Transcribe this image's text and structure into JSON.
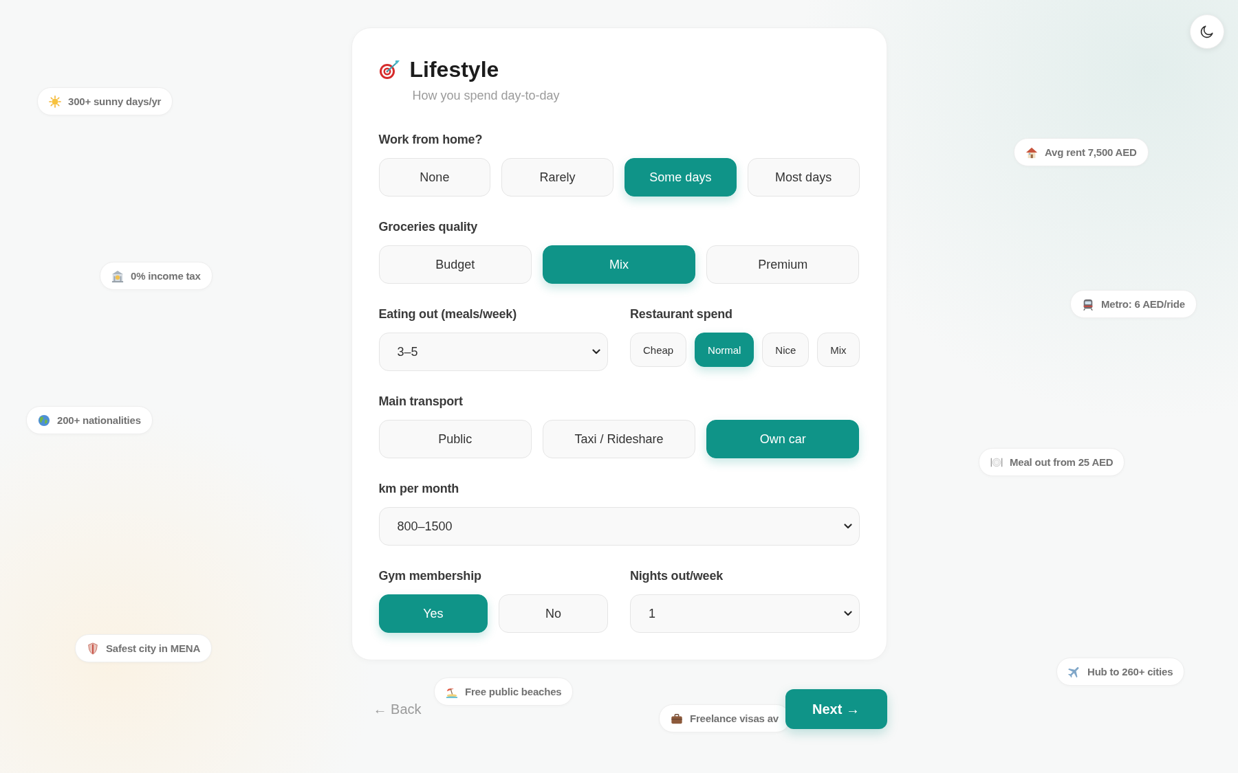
{
  "fact_chips": [
    {
      "label": "300+ sunny days/yr"
    },
    {
      "label": "Avg rent 7,500 AED"
    },
    {
      "label": "0% income tax"
    },
    {
      "label": "Metro: 6 AED/ride"
    },
    {
      "label": "200+ nationalities"
    },
    {
      "label": "Meal out from 25 AED"
    },
    {
      "label": "Safest city in MENA"
    },
    {
      "label": "Hub to 260+ cities"
    },
    {
      "label": "Free public beaches"
    },
    {
      "label": "Freelance visas av"
    }
  ],
  "card": {
    "title": "Lifestyle",
    "subtitle": "How you spend day-to-day",
    "rows": [
      {
        "fields": [
          {
            "label": "Work from home?",
            "kind": "choice",
            "options": [
              {
                "label": "None",
                "selected": false
              },
              {
                "label": "Rarely",
                "selected": false
              },
              {
                "label": "Some days",
                "selected": true
              },
              {
                "label": "Most days",
                "selected": false
              }
            ]
          }
        ]
      },
      {
        "fields": [
          {
            "label": "Groceries quality",
            "kind": "choice",
            "options": [
              {
                "label": "Budget",
                "selected": false
              },
              {
                "label": "Mix",
                "selected": true
              },
              {
                "label": "Premium",
                "selected": false
              }
            ]
          }
        ]
      },
      {
        "fields": [
          {
            "label": "Eating out (meals/week)",
            "kind": "select",
            "value": "3–5"
          },
          {
            "label": "Restaurant spend",
            "kind": "pills",
            "options": [
              {
                "label": "Cheap",
                "selected": false
              },
              {
                "label": "Normal",
                "selected": true
              },
              {
                "label": "Nice",
                "selected": false
              },
              {
                "label": "Mix",
                "selected": false
              }
            ]
          }
        ]
      },
      {
        "fields": [
          {
            "label": "Main transport",
            "kind": "choice",
            "options": [
              {
                "label": "Public",
                "selected": false
              },
              {
                "label": "Taxi / Rideshare",
                "selected": false
              },
              {
                "label": "Own car",
                "selected": true
              }
            ]
          }
        ]
      },
      {
        "fields": [
          {
            "label": "km per month",
            "kind": "select",
            "value": "800–1500"
          }
        ]
      },
      {
        "fields": [
          {
            "label": "Gym membership",
            "kind": "choice",
            "options": [
              {
                "label": "Yes",
                "selected": true
              },
              {
                "label": "No",
                "selected": false
              }
            ]
          },
          {
            "label": "Nights out/week",
            "kind": "select",
            "value": "1"
          }
        ]
      }
    ]
  },
  "navigation": {
    "back": "← Back",
    "next": "Next →"
  }
}
